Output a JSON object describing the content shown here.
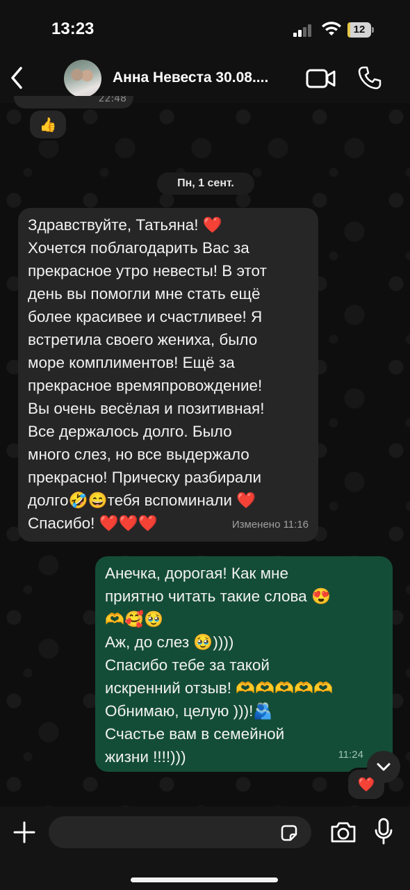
{
  "status_bar": {
    "time": "13:23",
    "battery_level": "12",
    "battery_fraction": 0.12,
    "battery_color": "#e5c84a"
  },
  "header": {
    "contact_name": "Анна Невеста 30.08....",
    "back_icon": "chevron-left-icon",
    "video_icon": "video-camera-icon",
    "call_icon": "phone-icon"
  },
  "previous_message": {
    "time_fragment": "22:48",
    "reaction": "👍"
  },
  "date_divider": "Пн, 1 сент.",
  "messages": [
    {
      "direction": "incoming",
      "lines": [
        "Здравствуйте, Татьяна! ❤️",
        "Хочется поблагодарить Вас за",
        "прекрасное утро невесты! В этот",
        "день вы помогли мне стать ещё",
        "более красивее и счастливее! Я",
        "встретила своего жениха, было",
        "море комплиментов! Ещё за",
        "прекрасное времяпровождение!",
        "Вы очень весёлая и позитивная!",
        "Все держалось долго. Было",
        "много слез, но все выдержало",
        "прекрасно! Прическу разбирали",
        "долго🤣😄тебя вспоминали ❤️",
        "Спасибо! ❤️❤️❤️"
      ],
      "meta": "Изменено 11:16"
    },
    {
      "direction": "outgoing",
      "lines": [
        "Анечка, дорогая! Как мне",
        "приятно читать такие слова 😍",
        "🫶🥰🥹",
        "Аж, до слез 🥹))))",
        "Спасибо тебе за такой",
        "искренний отзыв!  🫶🫶🫶🫶🫶",
        "Обнимаю, целую )))!🫂",
        "Счастье вам в семейной",
        "жизни !!!!)))"
      ],
      "meta": "11:24",
      "reaction": "❤️"
    }
  ],
  "composer": {
    "placeholder": "",
    "plus_icon": "plus-icon",
    "sticker_icon": "sticker-icon",
    "camera_icon": "camera-icon",
    "mic_icon": "microphone-icon"
  },
  "colors": {
    "incoming_bubble": "#262626",
    "outgoing_bubble": "#144d37",
    "heart": "#e0203a"
  }
}
